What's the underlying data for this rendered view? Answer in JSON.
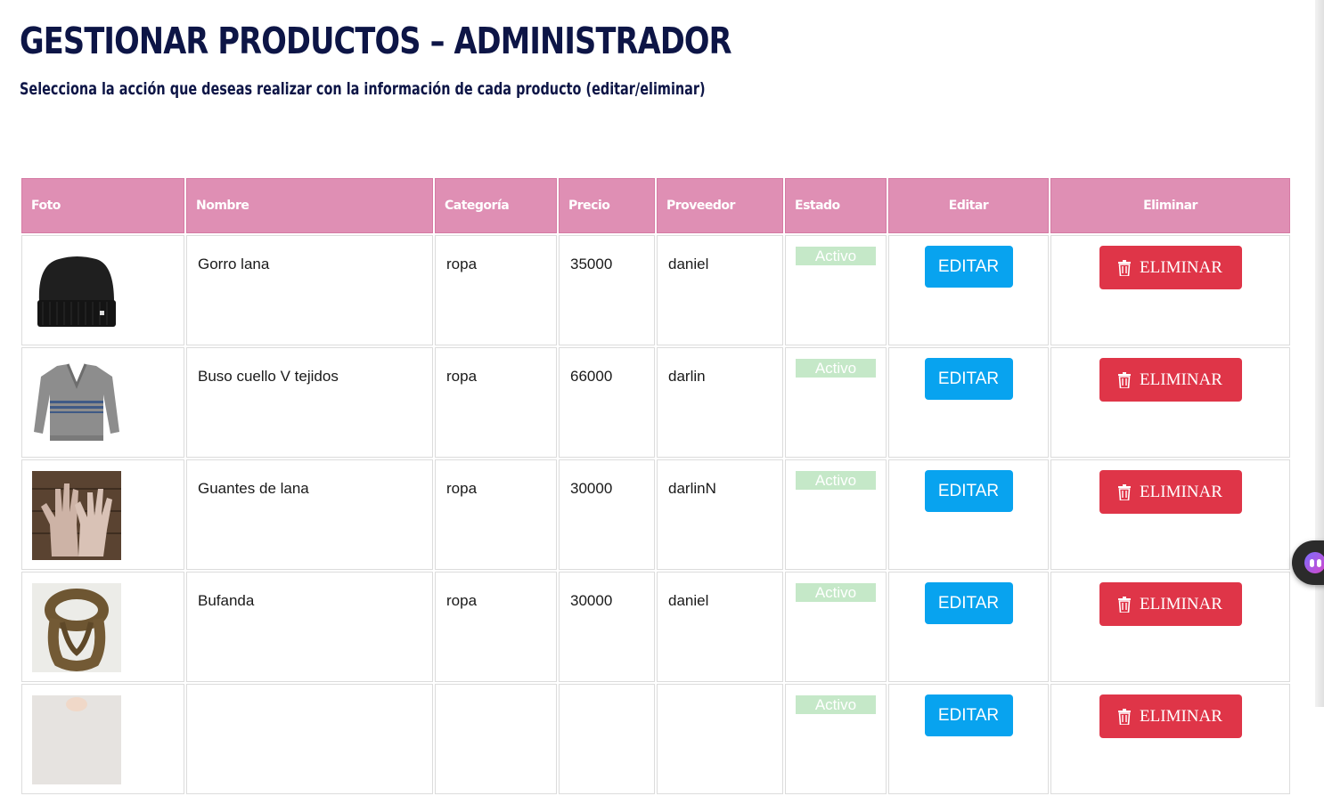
{
  "page": {
    "title": "GESTIONAR PRODUCTOS – ADMINISTRADOR",
    "subtitle": "Selecciona la acción que deseas realizar con la información de cada producto (editar/eliminar)"
  },
  "table": {
    "headers": {
      "foto": "Foto",
      "nombre": "Nombre",
      "categoria": "Categoría",
      "precio": "Precio",
      "proveedor": "Proveedor",
      "estado": "Estado",
      "editar": "Editar",
      "eliminar": "Eliminar"
    },
    "rows": [
      {
        "image": "black-wool-beanie",
        "nombre": "Gorro lana",
        "categoria": "ropa",
        "precio": "35000",
        "proveedor": "daniel",
        "estado": "Activo",
        "edit_label": "EDITAR",
        "delete_label": "ELIMINAR"
      },
      {
        "image": "grey-v-neck-sweater",
        "nombre": "Buso cuello V tejidos",
        "categoria": "ropa",
        "precio": "66000",
        "proveedor": "darlin",
        "estado": "Activo",
        "edit_label": "EDITAR",
        "delete_label": "ELIMINAR"
      },
      {
        "image": "wool-gloves",
        "nombre": "Guantes de lana",
        "categoria": "ropa",
        "precio": "30000",
        "proveedor": "darlinN",
        "estado": "Activo",
        "edit_label": "EDITAR",
        "delete_label": "ELIMINAR"
      },
      {
        "image": "brown-infinity-scarf",
        "nombre": "Bufanda",
        "categoria": "ropa",
        "precio": "30000",
        "proveedor": "daniel",
        "estado": "Activo",
        "edit_label": "EDITAR",
        "delete_label": "ELIMINAR"
      },
      {
        "image": "product-photo",
        "nombre": "",
        "categoria": "",
        "precio": "",
        "proveedor": "",
        "estado": "Activo",
        "edit_label": "EDITAR",
        "delete_label": "ELIMINAR"
      }
    ]
  },
  "colors": {
    "title": "#0d1546",
    "header_bg": "#df8fb4",
    "badge_active": "#c5e8c8",
    "edit_button": "#08a3ef",
    "delete_button": "#df3548"
  },
  "icons": {
    "delete": "trash-icon",
    "assistant": "assistant-bot-icon"
  }
}
